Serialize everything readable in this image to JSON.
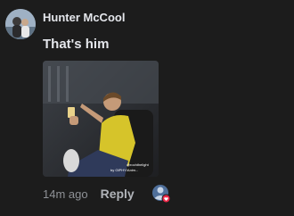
{
  "comment": {
    "author": "Hunter McCool",
    "text": "That's him",
    "timestamp": "14m ago",
    "reply_label": "Reply",
    "avatar_icon": "user-avatar",
    "reaction_icon": "reactor-avatar-with-love-badge",
    "media": {
      "type": "gif",
      "watermark_line1": "@rochthelight",
      "watermark_line2": "by GIPHY/Anim..."
    }
  },
  "colors": {
    "background": "#1c1c1c",
    "text_primary": "#e4e6eb",
    "text_secondary": "#8e9196",
    "reply": "#b0b3b8",
    "badge": "#f02849"
  }
}
